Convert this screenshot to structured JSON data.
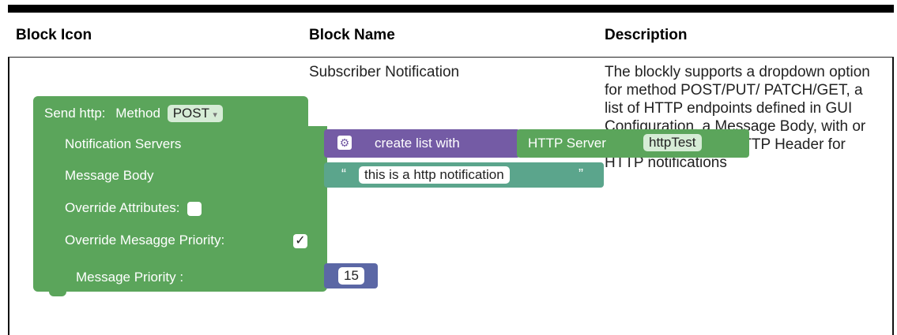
{
  "table": {
    "headers": [
      "Block Icon",
      "Block Name",
      "Description"
    ],
    "row": {
      "block_name": "Subscriber Notification",
      "description": "The blockly supports a dropdown option for method POST/PUT/ PATCH/GET, a list of HTTP endpoints defined in GUI Configuration, a Message Body, with or without overridden HTTP Header for HTTP notifications"
    }
  },
  "block": {
    "title": "Send http:",
    "method_label": "Method",
    "method_value": "POST",
    "rows": [
      "Notification Servers",
      "Message Body",
      "Override Attributes:",
      "Override Mesagge Priority:",
      "Message Priority :"
    ],
    "list_label": "create list with",
    "server_label": "HTTP Server",
    "server_value": "httpTest",
    "message_text": "this is a http notification",
    "quote_open": "“",
    "quote_close": "”",
    "priority_value": "15",
    "override_priority_checked": "✓"
  },
  "colors": {
    "block_green": "#5ba55b",
    "block_purple": "#745ba5",
    "text_block": "#5ba58c",
    "number_block": "#5b67a5"
  }
}
